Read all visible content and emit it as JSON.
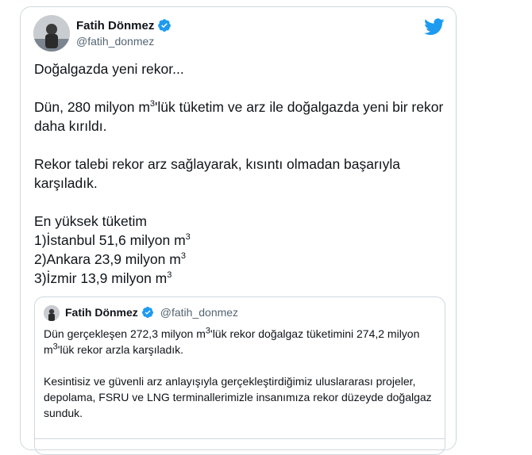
{
  "tweet": {
    "author_name": "Fatih Dönmez",
    "author_handle": "@fatih_donmez",
    "line1": "Doğalgazda yeni rekor...",
    "para2_a": "Dün, 280 milyon m",
    "para2_sup": "3",
    "para2_b": "'lük tüketim ve arz ile doğalgazda yeni bir rekor daha kırıldı.",
    "para3": "Rekor talebi rekor arz sağlayarak, kısıntı olmadan başarıyla karşıladık.",
    "list_title": "En yüksek tüketim",
    "list": [
      {
        "text": "1)İstanbul 51,6 milyon m",
        "sup": "3"
      },
      {
        "text": "2)Ankara 23,9 milyon m",
        "sup": "3"
      },
      {
        "text": "3)İzmir 13,9 milyon m",
        "sup": "3"
      }
    ]
  },
  "quote": {
    "author_name": "Fatih Dönmez",
    "author_handle": "@fatih_donmez",
    "p1_a": "Dün gerçekleşen 272,3 milyon m",
    "p1_sup1": "3",
    "p1_b": "'lük rekor doğalgaz tüketimini 274,2 milyon m",
    "p1_sup2": "3",
    "p1_c": "'lük rekor arzla karşıladık.",
    "p2": "Kesintisiz ve güvenli arz anlayışıyla gerçekleştirdiğimiz uluslararası projeler, depolama, FSRU ve LNG terminallerimizle insanımıza rekor düzeyde doğalgaz sunduk."
  },
  "colors": {
    "twitter_blue": "#1d9bf0",
    "handle_gray": "#536471",
    "border": "#cfd9de"
  }
}
